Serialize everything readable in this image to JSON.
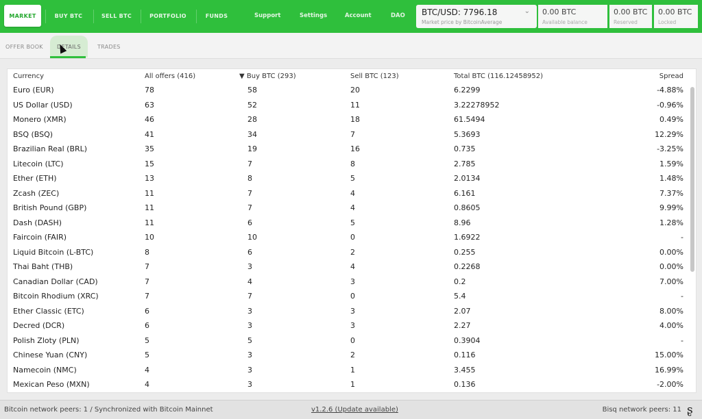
{
  "nav": {
    "items": [
      {
        "label": "MARKET"
      },
      {
        "label": "BUY BTC"
      },
      {
        "label": "SELL BTC"
      },
      {
        "label": "PORTFOLIO"
      },
      {
        "label": "FUNDS"
      }
    ],
    "right": [
      {
        "label": "Support"
      },
      {
        "label": "Settings"
      },
      {
        "label": "Account"
      },
      {
        "label": "DAO"
      }
    ]
  },
  "price": {
    "value": "BTC/USD: 7796.18",
    "sub": "Market price by BitcoinAverage"
  },
  "balances": [
    {
      "value": "0.00 BTC",
      "sub": "Available balance"
    },
    {
      "value": "0.00 BTC",
      "sub": "Reserved"
    },
    {
      "value": "0.00 BTC",
      "sub": "Locked"
    }
  ],
  "subtabs": [
    {
      "label": "OFFER BOOK"
    },
    {
      "label": "DETAILS"
    },
    {
      "label": "TRADES"
    }
  ],
  "table": {
    "headers": {
      "currency": "Currency",
      "all": "All offers (416)",
      "buy": "▼ Buy BTC (293)",
      "sell": "Sell BTC (123)",
      "total": "Total BTC (116.12458952)",
      "spread": "Spread"
    },
    "rows": [
      [
        "Euro (EUR)",
        "78",
        "58",
        "20",
        "6.2299",
        "-4.88%"
      ],
      [
        "US Dollar (USD)",
        "63",
        "52",
        "11",
        "3.22278952",
        "-0.96%"
      ],
      [
        "Monero (XMR)",
        "46",
        "28",
        "18",
        "61.5494",
        "0.49%"
      ],
      [
        "BSQ (BSQ)",
        "41",
        "34",
        "7",
        "5.3693",
        "12.29%"
      ],
      [
        "Brazilian Real (BRL)",
        "35",
        "19",
        "16",
        "0.735",
        "-3.25%"
      ],
      [
        "Litecoin (LTC)",
        "15",
        "7",
        "8",
        "2.785",
        "1.59%"
      ],
      [
        "Ether (ETH)",
        "13",
        "8",
        "5",
        "2.0134",
        "1.48%"
      ],
      [
        "Zcash (ZEC)",
        "11",
        "7",
        "4",
        "6.161",
        "7.37%"
      ],
      [
        "British Pound (GBP)",
        "11",
        "7",
        "4",
        "0.8605",
        "9.99%"
      ],
      [
        "Dash (DASH)",
        "11",
        "6",
        "5",
        "8.96",
        "1.28%"
      ],
      [
        "Faircoin (FAIR)",
        "10",
        "10",
        "0",
        "1.6922",
        "-"
      ],
      [
        "Liquid Bitcoin (L-BTC)",
        "8",
        "6",
        "2",
        "0.255",
        "0.00%"
      ],
      [
        "Thai Baht (THB)",
        "7",
        "3",
        "4",
        "0.2268",
        "0.00%"
      ],
      [
        "Canadian Dollar (CAD)",
        "7",
        "4",
        "3",
        "0.2",
        "7.00%"
      ],
      [
        "Bitcoin Rhodium (XRC)",
        "7",
        "7",
        "0",
        "5.4",
        "-"
      ],
      [
        "Ether Classic (ETC)",
        "6",
        "3",
        "3",
        "2.07",
        "8.00%"
      ],
      [
        "Decred (DCR)",
        "6",
        "3",
        "3",
        "2.27",
        "4.00%"
      ],
      [
        "Polish Zloty (PLN)",
        "5",
        "5",
        "0",
        "0.3904",
        "-"
      ],
      [
        "Chinese Yuan (CNY)",
        "5",
        "3",
        "2",
        "0.116",
        "15.00%"
      ],
      [
        "Namecoin (NMC)",
        "4",
        "3",
        "1",
        "3.455",
        "16.99%"
      ],
      [
        "Mexican Peso (MXN)",
        "4",
        "3",
        "1",
        "0.136",
        "-2.00%"
      ]
    ]
  },
  "footer": {
    "peers": "Bitcoin network peers: 1 / Synchronized with Bitcoin Mainnet",
    "version": "v1.2.6 (Update available)",
    "bisq_peers": "Bisq network peers: 11"
  },
  "colors": {
    "accent": "#2fbf3c"
  }
}
